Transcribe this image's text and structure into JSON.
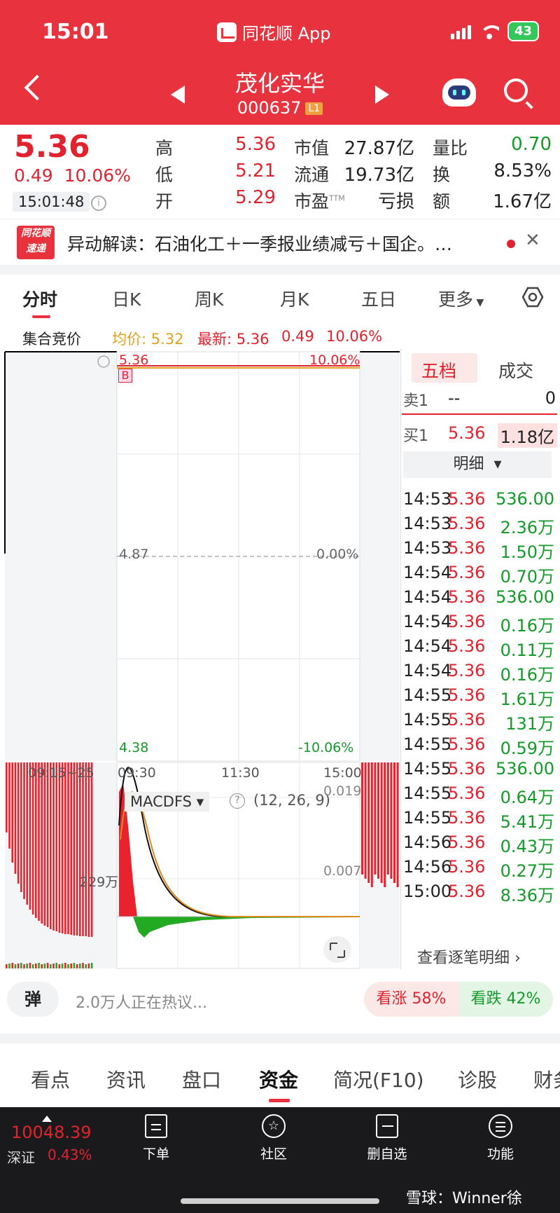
{
  "status": {
    "time": "15:01",
    "app_name": "同花顺 App",
    "battery": "43"
  },
  "header": {
    "stock_name": "茂化实华",
    "stock_code": "000637",
    "level": "L1"
  },
  "quote": {
    "price": "5.36",
    "change": "0.49",
    "change_pct": "10.06%",
    "time": "15:01:48",
    "labels": {
      "high": "高",
      "low": "低",
      "open": "开",
      "mcap": "市值",
      "float": "流通",
      "pe": "市盈",
      "pe_sup": "TTM",
      "vol_ratio": "量比",
      "turnover": "换",
      "amount": "额"
    },
    "values": {
      "high": "5.36",
      "low": "5.21",
      "open": "5.29",
      "mcap": "27.87亿",
      "float": "19.73亿",
      "pe": "亏损",
      "vol_ratio": "0.70",
      "turnover": "8.53%",
      "amount": "1.67亿"
    }
  },
  "news": {
    "logo_top": "同花顺",
    "logo_bottom": "速递",
    "text": "异动解读：石油化工＋一季报业绩减亏＋国企。…"
  },
  "chart_tabs": [
    "分时",
    "日K",
    "周K",
    "月K",
    "五日",
    "更多"
  ],
  "subheader": {
    "auction": "集合竞价",
    "avg": "均价: 5.32",
    "latest": "最新: 5.36",
    "chg": "0.49",
    "pct": "10.06%"
  },
  "chart": {
    "price_top": "5.36",
    "pct_top": "10.06%",
    "price_mid": "4.87",
    "pct_mid": "0.00%",
    "price_bottom": "4.38",
    "pct_bottom": "-10.06%",
    "b_marker": "B",
    "help_mark": "?",
    "times": {
      "auction": "09:15~25",
      "open": "09:30",
      "mid": "11:30",
      "close": "15:00"
    },
    "volume_label": "229万",
    "indicator": "MACDFS",
    "indicator_params": "(12, 26, 9)",
    "macd_top": "0.019",
    "macd_mid": "0.007"
  },
  "orderbook": {
    "tabs": [
      "五档",
      "成交"
    ],
    "sell1": {
      "label": "卖1",
      "price": "--",
      "volume": "0"
    },
    "buy1": {
      "label": "买1",
      "price": "5.36",
      "volume": "1.18亿"
    },
    "detail_label": "明细",
    "trades": [
      {
        "time": "14:53",
        "price": "5.36",
        "vol": "536.00"
      },
      {
        "time": "14:53",
        "price": "5.36",
        "vol": "2.36万"
      },
      {
        "time": "14:53",
        "price": "5.36",
        "vol": "1.50万"
      },
      {
        "time": "14:54",
        "price": "5.36",
        "vol": "0.70万"
      },
      {
        "time": "14:54",
        "price": "5.36",
        "vol": "536.00"
      },
      {
        "time": "14:54",
        "price": "5.36",
        "vol": "0.16万"
      },
      {
        "time": "14:54",
        "price": "5.36",
        "vol": "0.11万"
      },
      {
        "time": "14:54",
        "price": "5.36",
        "vol": "0.16万"
      },
      {
        "time": "14:55",
        "price": "5.36",
        "vol": "1.61万"
      },
      {
        "time": "14:55",
        "price": "5.36",
        "vol": "131万"
      },
      {
        "time": "14:55",
        "price": "5.36",
        "vol": "0.59万"
      },
      {
        "time": "14:55",
        "price": "5.36",
        "vol": "536.00"
      },
      {
        "time": "14:55",
        "price": "5.36",
        "vol": "0.64万"
      },
      {
        "time": "14:55",
        "price": "5.36",
        "vol": "5.41万"
      },
      {
        "time": "14:56",
        "price": "5.36",
        "vol": "0.43万"
      },
      {
        "time": "14:56",
        "price": "5.36",
        "vol": "0.27万"
      },
      {
        "time": "15:00",
        "price": "5.36",
        "vol": "8.36万"
      }
    ],
    "view_all": "查看逐笔明细 ›"
  },
  "sentiment": {
    "danmu": "弹",
    "hot_text": "2.0万人正在热议...",
    "up": "看涨 58%",
    "down": "看跌 42%"
  },
  "info_tabs": [
    "看点",
    "资讯",
    "盘口",
    "资金",
    "简况(F10)",
    "诊股",
    "财务"
  ],
  "bottom": {
    "index_value": "10048.39",
    "index_name": "深证",
    "index_change": "0.43%",
    "nav": [
      "下单",
      "社区",
      "删自选",
      "功能"
    ],
    "watermark": "雪球：Winner徐"
  },
  "colors": {
    "header_red": "#e8323d",
    "up_red": "#e0232e",
    "down_green": "#159a2a",
    "avg_line": "#e0a020"
  }
}
